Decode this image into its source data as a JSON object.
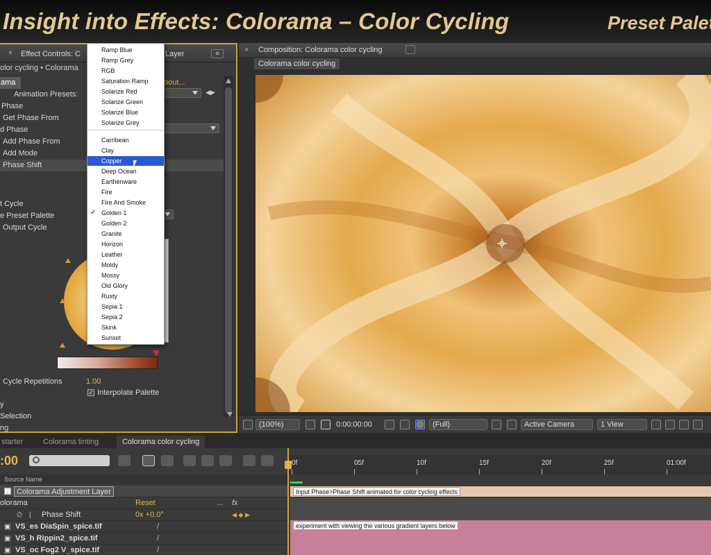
{
  "banner": {
    "title": "Insight into Effects: Colorama – Color Cycling",
    "right_text": "Preset Palet"
  },
  "effect_controls": {
    "tab_label": "Effect Controls: C",
    "tab_label_tail": "Layer",
    "breadcrumb": "olor cycling • Colorama",
    "effect_name": "ama",
    "about": "bout...",
    "rows": [
      {
        "label": "Animation Presets:",
        "indent": 20
      },
      {
        "label": "Phase",
        "indent": 2
      },
      {
        "label": "Get Phase From",
        "indent": 4
      },
      {
        "label": "d Phase",
        "indent": 0
      },
      {
        "label": "Add Phase From",
        "indent": 4
      },
      {
        "label": "Add Mode",
        "indent": 4
      },
      {
        "label": "Phase Shift",
        "indent": 4
      },
      {
        "label": "t Cycle",
        "indent": 0
      },
      {
        "label": "e Preset Palette",
        "indent": 0
      },
      {
        "label": "Output Cycle",
        "indent": 4
      }
    ],
    "cycle_repetitions_label": "Cycle Repetitions",
    "cycle_repetitions_value": "1.00",
    "interpolate_label": "Interpolate Palette",
    "interpolate_checked": "✓",
    "bottom_rows": [
      "y",
      "Selection",
      "ng"
    ]
  },
  "popup_menu": {
    "items_top": [
      "Ramp Blue",
      "Ramp Grey",
      "RGB",
      "Saturation Ramp",
      "Solarize Red",
      "Solarize Green",
      "Solarize Blue",
      "Solarize Grey"
    ],
    "items_bottom": [
      "Carribean",
      "Clay",
      "Copper",
      "Deep Ocean",
      "Earthenware",
      "Fire",
      "Fire And Smoke",
      "Golden 1",
      "Golden 2",
      "Granite",
      "Horizon",
      "Leather",
      "Moldy",
      "Mossy",
      "Old Glory",
      "Rusty",
      "Sepia 1",
      "Sepia 2",
      "Skink",
      "Sunset"
    ],
    "highlighted": "Copper",
    "checked": "Golden 1",
    "check_mark": "✓"
  },
  "composition": {
    "tab_label": "Composition: Colorama color cycling",
    "sub_tab": "Colorama color cycling",
    "zoom": "(100%)",
    "timecode": "0:00:00:00",
    "resolution": "(Full)",
    "camera": "Active Camera",
    "view": "1 View"
  },
  "timeline": {
    "tabs": [
      "starter",
      "Colorama tinting",
      "Colorama color cycling"
    ],
    "active_tab": "Colorama color cycling",
    "current_time": ":00",
    "ruler": [
      "0f",
      "05f",
      "10f",
      "15f",
      "20f",
      "25f",
      "01:00f"
    ],
    "header_label": "Source Name",
    "layers": [
      {
        "name": "Colorama Adjustment Layer",
        "selected": true
      },
      {
        "name": "olorama",
        "extra": "Reset",
        "extra2": "..."
      },
      {
        "name": "Phase Shift",
        "value": "0x +0.0°"
      },
      {
        "name": "VS_es DiaSpin_spice.tif"
      },
      {
        "name": "VS_h Rippin2_spice.tif"
      },
      {
        "name": "VS_oc Fog2 V_spice.tif"
      }
    ],
    "comment_1": "Input Phase>Phase Shift animated for color cycling effects",
    "comment_2": "experiment with viewing the various gradient layers below",
    "colors": {
      "accent": "#e6b64c",
      "bar_pink": "#c77f9a",
      "bar_beige": "#e7c9b1"
    }
  }
}
